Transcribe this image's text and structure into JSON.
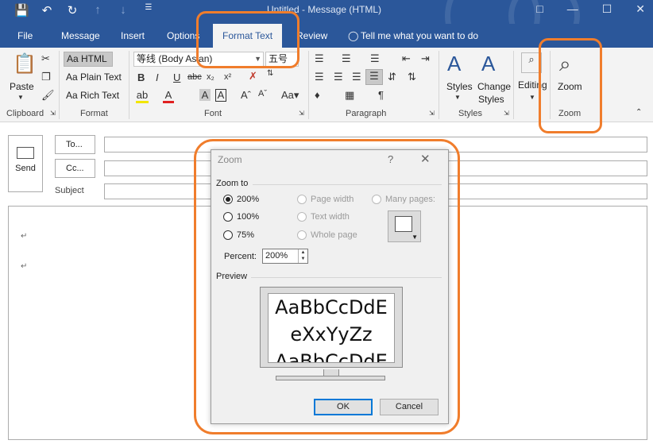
{
  "window": {
    "title": "Untitled  -  Message (HTML)",
    "qat_icons": [
      "save-icon",
      "undo-icon",
      "redo-icon",
      "up-arrow-icon",
      "down-arrow-icon",
      "customize-qat-icon"
    ],
    "controls": [
      "restore-icon",
      "minimize-icon",
      "maximize-icon",
      "close-icon"
    ]
  },
  "tabs": [
    {
      "label": "File"
    },
    {
      "label": "Message"
    },
    {
      "label": "Insert"
    },
    {
      "label": "Options"
    },
    {
      "label": "Format Text",
      "active": true
    },
    {
      "label": "Review"
    }
  ],
  "tell_me": "Tell me what you want to do",
  "ribbon": {
    "clipboard": {
      "label": "Clipboard",
      "paste": "Paste"
    },
    "format": {
      "label": "Format",
      "html": "Aa HTML",
      "plain": "Aa Plain Text",
      "rich": "Aa Rich Text"
    },
    "font": {
      "label": "Font",
      "font_name": "等线 (Body Asian)",
      "font_size": "五号"
    },
    "paragraph": {
      "label": "Paragraph"
    },
    "styles": {
      "label": "Styles",
      "styles_btn": "Styles",
      "change_styles_1": "Change",
      "change_styles_2": "Styles"
    },
    "editing": {
      "label": "Editing"
    },
    "zoom": {
      "label": "Zoom",
      "zoom_btn": "Zoom"
    }
  },
  "compose": {
    "send": "Send",
    "to": "To...",
    "cc": "Cc...",
    "subject": "Subject",
    "paragraph_mark": "↵"
  },
  "dialog": {
    "title": "Zoom",
    "help": "?",
    "close": "✕",
    "zoom_to_label": "Zoom to",
    "options": {
      "p200": "200%",
      "p100": "100%",
      "p75": "75%",
      "page_width": "Page width",
      "text_width": "Text width",
      "whole_page": "Whole page",
      "many_pages": "Many pages:"
    },
    "selected": "200%",
    "percent_label": "Percent:",
    "percent_value": "200%",
    "preview_label": "Preview",
    "preview_line1": "AaBbCcDdE",
    "preview_line2": "eXxYyZz",
    "preview_line3": "AaBbCcDdE",
    "ok": "OK",
    "cancel": "Cancel"
  },
  "colors": {
    "titlebar": "#2b579a",
    "ribbon": "#f3f3f3",
    "highlight": "#f07d2c",
    "dialog_bg": "#f0f0f0",
    "ok_border": "#0078d7"
  }
}
